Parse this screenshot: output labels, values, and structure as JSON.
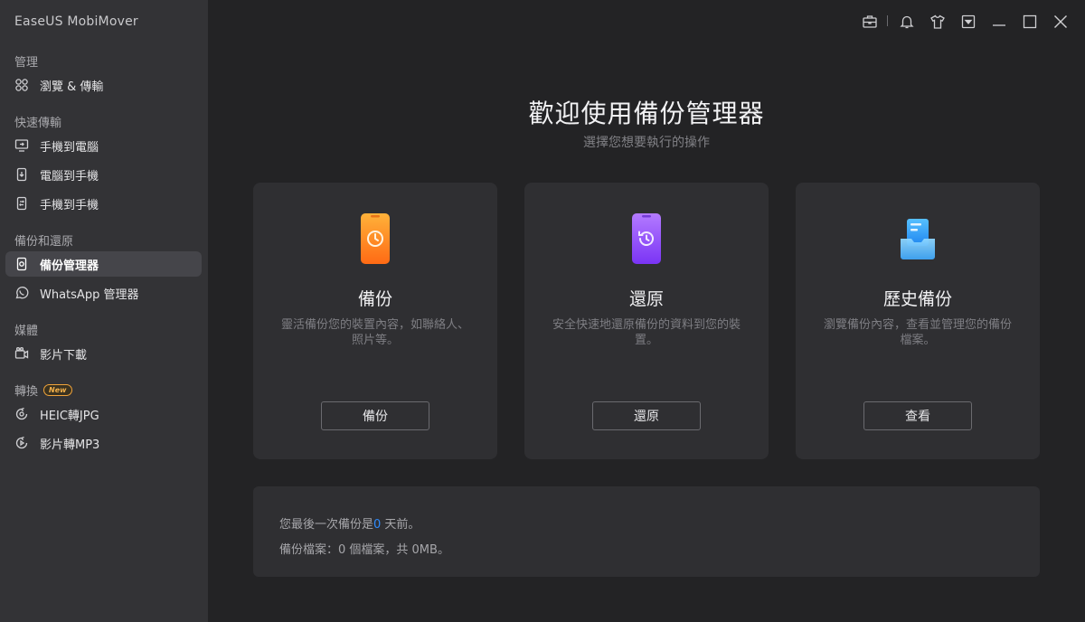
{
  "app": {
    "title": "EaseUS MobiMover"
  },
  "sidebar": {
    "sections": [
      {
        "label": "管理"
      },
      {
        "label": "快速傳輸"
      },
      {
        "label": "備份和還原"
      },
      {
        "label": "媒體"
      },
      {
        "label": "轉換",
        "badge": "New"
      }
    ],
    "items": [
      {
        "label": "瀏覽 & 傳輸",
        "icon": "grid-icon"
      },
      {
        "label": "手機到電腦",
        "icon": "phone-to-pc-icon"
      },
      {
        "label": "電腦到手機",
        "icon": "pc-to-phone-icon"
      },
      {
        "label": "手機到手機",
        "icon": "phone-to-phone-icon"
      },
      {
        "label": "備份管理器",
        "icon": "backup-manager-icon",
        "active": true
      },
      {
        "label": "WhatsApp 管理器",
        "icon": "whatsapp-icon"
      },
      {
        "label": "影片下載",
        "icon": "video-download-icon"
      },
      {
        "label": "HEIC轉JPG",
        "icon": "heic-convert-icon"
      },
      {
        "label": "影片轉MP3",
        "icon": "video-to-mp3-icon"
      }
    ]
  },
  "titlebar": {
    "icons": [
      "toolbox-icon",
      "bell-icon",
      "shirt-icon",
      "dropdown-menu-icon",
      "minimize-icon",
      "maximize-icon",
      "close-icon"
    ]
  },
  "main": {
    "heading": "歡迎使用備份管理器",
    "subheading": "選擇您想要執行的操作",
    "cards": [
      {
        "title": "備份",
        "desc": "靈活備份您的裝置內容，如聯絡人、照片等。",
        "button": "備份",
        "icon": "backup-phone-icon",
        "color": "#ff8a1f"
      },
      {
        "title": "還原",
        "desc": "安全快速地還原備份的資料到您的裝置。",
        "button": "還原",
        "icon": "restore-phone-icon",
        "color": "#8d4dff"
      },
      {
        "title": "歷史備份",
        "desc": "瀏覽備份內容，查看並管理您的備份檔案。",
        "button": "查看",
        "icon": "history-backup-icon",
        "color": "#2f9bff"
      }
    ],
    "info": {
      "last_backup_prefix": "您最後一次備份是",
      "last_backup_days": "0",
      "last_backup_suffix": " 天前。",
      "files_line": "備份檔案：0 個檔案，共 0MB。"
    }
  },
  "colors": {
    "accent": "#2f8cff",
    "sidebar_bg": "#333336",
    "main_bg": "#232325",
    "card_bg": "#2f2f32"
  }
}
